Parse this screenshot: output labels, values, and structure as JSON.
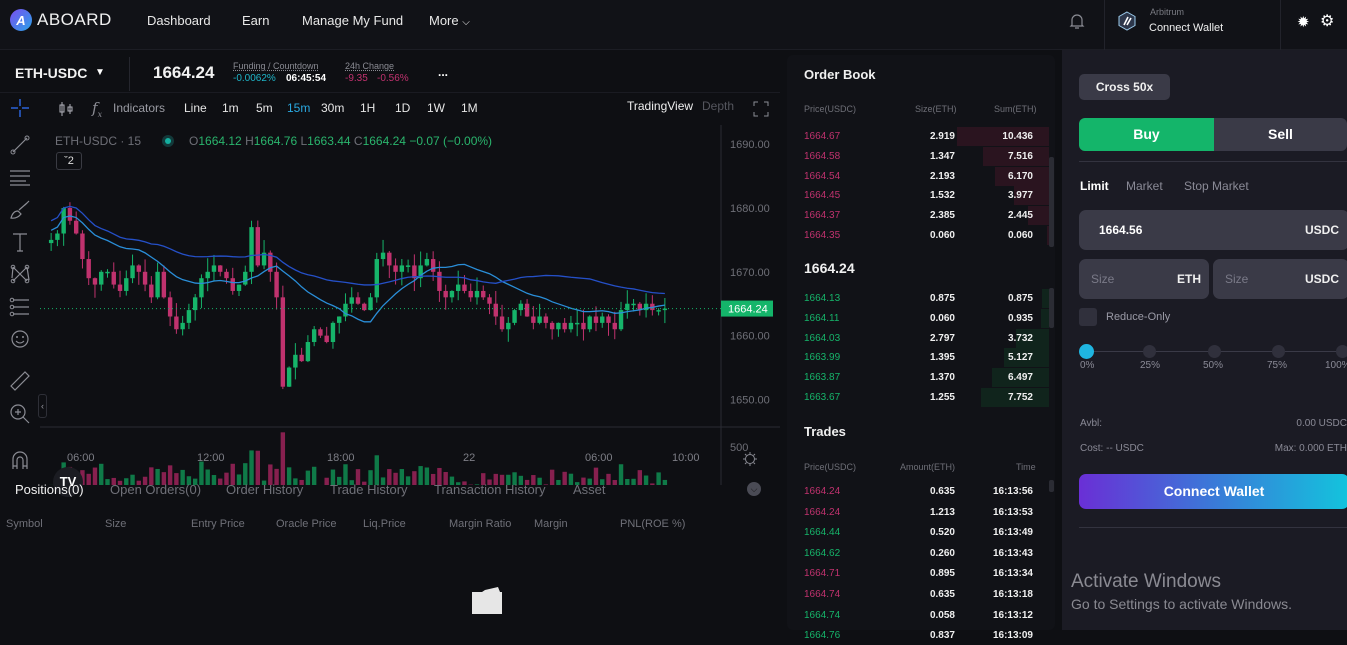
{
  "topbar": {
    "brand": "ABOARD",
    "nav": [
      "Dashboard",
      "Earn",
      "Manage My Fund",
      "More"
    ],
    "network": "Arbitrum",
    "connect_wallet": "Connect Wallet"
  },
  "ticker": {
    "pair": "ETH-USDC",
    "last_price": "1664.24",
    "funding_label": "Funding / Countdown",
    "funding_rate": "-0.0062%",
    "countdown": "06:45:54",
    "change_label": "24h Change",
    "change_abs": "-9.35",
    "change_pct": "-0.56%",
    "more": "..."
  },
  "chart_toolbar": {
    "indicators": "Indicators",
    "intervals": [
      "Line",
      "1m",
      "5m",
      "15m",
      "30m",
      "1H",
      "1D",
      "1W",
      "1M"
    ],
    "active_interval": "15m",
    "views": [
      "TradingView",
      "Depth"
    ],
    "active_view": "TradingView"
  },
  "chart_legend": {
    "symbol": "ETH-USDC · 15",
    "o_label": "O",
    "o": "1664.12",
    "h_label": "H",
    "h": "1664.76",
    "l_label": "L",
    "l": "1663.44",
    "c_label": "C",
    "c": "1664.24",
    "change": "−0.07 (−0.00%)",
    "indicator_count": "2"
  },
  "chart_data": {
    "type": "candlestick",
    "price_axis": [
      "1690.00",
      "1680.00",
      "1670.00",
      "1660.00",
      "1650.00"
    ],
    "ylim": [
      1646,
      1693
    ],
    "current_price_label": "1664.24",
    "current_price": 1664.24,
    "volume_axis": [
      "500"
    ],
    "x_ticks": [
      "06:00",
      "12:00",
      "18:00",
      "22",
      "06:00",
      "10:00"
    ],
    "close_path": [
      1675,
      1676,
      1680,
      1678,
      1676,
      1672,
      1669,
      1668,
      1670,
      1670,
      1668,
      1667,
      1669,
      1671,
      1670,
      1668,
      1666,
      1670,
      1666,
      1663,
      1661,
      1662,
      1664,
      1666,
      1669,
      1670,
      1671,
      1670,
      1669,
      1667,
      1668,
      1670,
      1677,
      1671,
      1673,
      1670,
      1666,
      1652,
      1655,
      1657,
      1656,
      1659,
      1661,
      1660,
      1659,
      1662,
      1663,
      1665,
      1666,
      1665,
      1664,
      1666,
      1672,
      1673,
      1671,
      1670,
      1671,
      1671,
      1669,
      1671,
      1672,
      1670,
      1667,
      1666,
      1667,
      1668,
      1667,
      1666,
      1667,
      1666,
      1665,
      1663,
      1661,
      1662,
      1664,
      1665,
      1663,
      1662,
      1663,
      1662,
      1661,
      1662,
      1661,
      1662,
      1662,
      1661,
      1663,
      1662,
      1663,
      1662,
      1661,
      1664,
      1665,
      1665,
      1664,
      1665,
      1664,
      1664,
      1664.24
    ],
    "volume_series_note": "relative bar heights, max ~ spike near 18:00"
  },
  "positions": {
    "tabs": [
      "Positions(0)",
      "Open Orders(0)",
      "Order History",
      "Trade History",
      "Transaction History",
      "Asset"
    ],
    "active_tab": "Positions(0)",
    "columns": [
      "Symbol",
      "Size",
      "Entry Price",
      "Oracle Price",
      "Liq.Price",
      "Margin Ratio",
      "Margin",
      "PNL(ROE %)"
    ]
  },
  "order_book": {
    "title": "Order Book",
    "headers": [
      "Price(USDC)",
      "Size(ETH)",
      "Sum(ETH)"
    ],
    "asks": [
      {
        "price": "1664.67",
        "size": "2.919",
        "sum": "10.436",
        "depth": 1.0
      },
      {
        "price": "1664.58",
        "size": "1.347",
        "sum": "7.516",
        "depth": 0.72
      },
      {
        "price": "1664.54",
        "size": "2.193",
        "sum": "6.170",
        "depth": 0.59
      },
      {
        "price": "1664.45",
        "size": "1.532",
        "sum": "3.977",
        "depth": 0.38
      },
      {
        "price": "1664.37",
        "size": "2.385",
        "sum": "2.445",
        "depth": 0.23
      },
      {
        "price": "1664.35",
        "size": "0.060",
        "sum": "0.060",
        "depth": 0.01
      }
    ],
    "mid_price": "1664.24",
    "bids": [
      {
        "price": "1664.13",
        "size": "0.875",
        "sum": "0.875",
        "depth": 0.08
      },
      {
        "price": "1664.11",
        "size": "0.060",
        "sum": "0.935",
        "depth": 0.09
      },
      {
        "price": "1664.03",
        "size": "2.797",
        "sum": "3.732",
        "depth": 0.36
      },
      {
        "price": "1663.99",
        "size": "1.395",
        "sum": "5.127",
        "depth": 0.49
      },
      {
        "price": "1663.87",
        "size": "1.370",
        "sum": "6.497",
        "depth": 0.62
      },
      {
        "price": "1663.67",
        "size": "1.255",
        "sum": "7.752",
        "depth": 0.74
      }
    ]
  },
  "trades": {
    "title": "Trades",
    "headers": [
      "Price(USDC)",
      "Amount(ETH)",
      "Time"
    ],
    "rows": [
      {
        "price": "1664.24",
        "amount": "0.635",
        "time": "16:13:56",
        "side": "sell"
      },
      {
        "price": "1664.24",
        "amount": "1.213",
        "time": "16:13:53",
        "side": "sell"
      },
      {
        "price": "1664.44",
        "amount": "0.520",
        "time": "16:13:49",
        "side": "buy"
      },
      {
        "price": "1664.62",
        "amount": "0.260",
        "time": "16:13:43",
        "side": "buy"
      },
      {
        "price": "1664.71",
        "amount": "0.895",
        "time": "16:13:34",
        "side": "sell"
      },
      {
        "price": "1664.74",
        "amount": "0.635",
        "time": "16:13:18",
        "side": "sell"
      },
      {
        "price": "1664.74",
        "amount": "0.058",
        "time": "16:13:12",
        "side": "buy"
      },
      {
        "price": "1664.76",
        "amount": "0.837",
        "time": "16:13:09",
        "side": "buy"
      }
    ]
  },
  "trade_panel": {
    "margin_mode": "Cross 50x",
    "buy": "Buy",
    "sell": "Sell",
    "order_types": [
      "Limit",
      "Market",
      "Stop Market"
    ],
    "active_order_type": "Limit",
    "price_value": "1664.56",
    "price_unit": "USDC",
    "size_placeholder": "Size",
    "size_unit_eth": "ETH",
    "size_unit_usdc": "USDC",
    "reduce_only": "Reduce-Only",
    "slider_marks": [
      "0%",
      "25%",
      "50%",
      "75%",
      "100%"
    ],
    "slider_value": 0,
    "avbl_label": "Avbl:",
    "avbl_value": "0.00 USDC",
    "cost": "Cost: -- USDC",
    "max": "Max: 0.000 ETH",
    "connect_wallet": "Connect Wallet"
  },
  "watermark": {
    "title": "Activate Windows",
    "subtitle": "Go to Settings to activate Windows."
  },
  "colors": {
    "up": "#16b46a",
    "down": "#c0326e",
    "accent": "#2aa8e0",
    "buy": "#14b56a"
  }
}
